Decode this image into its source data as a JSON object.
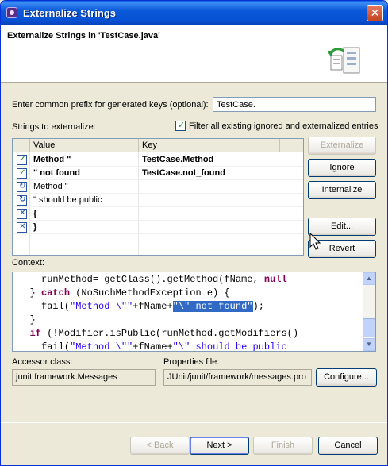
{
  "window": {
    "title": "Externalize Strings"
  },
  "header": {
    "title": "Externalize Strings in 'TestCase.java'"
  },
  "prefix": {
    "label": "Enter common prefix for generated keys (optional):",
    "value": "TestCase."
  },
  "strings": {
    "label": "Strings to externalize:",
    "filter_label": "Filter all existing ignored and externalized entries",
    "filter_checked": true,
    "columns": [
      "Value",
      "Key"
    ],
    "rows": [
      {
        "state": "translate",
        "value": "Method \"",
        "key": "TestCase.Method",
        "bold": true
      },
      {
        "state": "translate",
        "value": "\" not found",
        "key": "TestCase.not_found",
        "bold": true
      },
      {
        "state": "internalize",
        "value": "Method \"",
        "key": "",
        "bold": false
      },
      {
        "state": "internalize",
        "value": "\" should be public",
        "key": "",
        "bold": false
      },
      {
        "state": "ignore",
        "value": "{",
        "key": "",
        "bold": true
      },
      {
        "state": "ignore",
        "value": "}",
        "key": "",
        "bold": true
      }
    ]
  },
  "side_buttons": {
    "externalize": "Externalize",
    "ignore": "Ignore",
    "internalize": "Internalize",
    "edit": "Edit...",
    "revert": "Revert"
  },
  "context": {
    "label": "Context:",
    "line1": "runMethod= getClass().getMethod(fName, ",
    "line1_kw": "null",
    "line2_a": "} ",
    "line2_kw": "catch",
    "line2_b": " (NoSuchMethodException e) {",
    "line3_a": "fail(",
    "line3_str": "\"Method \\\"\"",
    "line3_b": "+fName+",
    "line3_sel": "\"\\\" not found\"",
    "line3_c": ");",
    "line4": "}",
    "line5_kw": "if",
    "line5_b": " (!Modifier.isPublic(runMethod.getModifiers()",
    "line6_a": "fail(",
    "line6_str1": "\"Method \\\"\"",
    "line6_b": "+fName+",
    "line6_str2": "\"\\\" should be public"
  },
  "accessor": {
    "label": "Accessor class:",
    "value": "junit.framework.Messages"
  },
  "properties": {
    "label": "Properties file:",
    "value": "JUnit/junit/framework/messages.pro"
  },
  "configure_label": "Configure...",
  "footer": {
    "back": "< Back",
    "next": "Next >",
    "finish": "Finish",
    "cancel": "Cancel"
  },
  "colors": {
    "titlebar": "#0a5be0",
    "selection": "#316ac5",
    "keyword": "#7f0055",
    "string": "#2a00ff"
  }
}
